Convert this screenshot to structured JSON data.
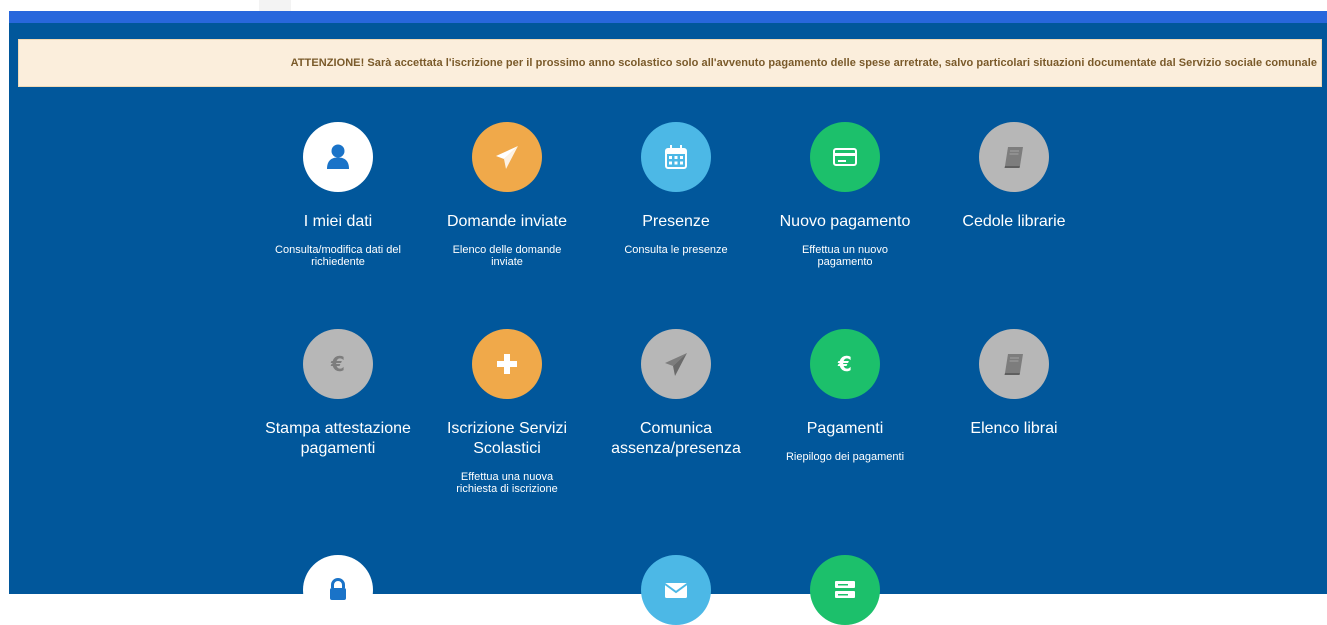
{
  "notice": {
    "text": "ATTENZIONE! Sarà accettata l'iscrizione per il prossimo anno scolastico solo all'avvenuto pagamento delle spese arretrate, salvo particolari situazioni documentate dal Servizio sociale comunale"
  },
  "tiles": [
    {
      "title": "I miei dati",
      "subtitle": "Consulta/modifica dati del richiedente",
      "icon": "user-icon",
      "color": "#ffffff"
    },
    {
      "title": "Domande inviate",
      "subtitle": "Elenco delle domande inviate",
      "icon": "paper-plane-icon",
      "color": "#f0a94a"
    },
    {
      "title": "Presenze",
      "subtitle": "Consulta le presenze",
      "icon": "calendar-icon",
      "color": "#4cb8e6"
    },
    {
      "title": "Nuovo pagamento",
      "subtitle": "Effettua un nuovo pagamento",
      "icon": "credit-card-icon",
      "color": "#1cc06b"
    },
    {
      "title": "Cedole librarie",
      "subtitle": "",
      "icon": "book-icon",
      "color": "#b7b7b7"
    },
    {
      "title": "Stampa attestazione pagamenti",
      "subtitle": "",
      "icon": "euro-icon",
      "color": "#b7b7b7"
    },
    {
      "title": "Iscrizione Servizi Scolastici",
      "subtitle": "Effettua una nuova richiesta di iscrizione",
      "icon": "plus-icon",
      "color": "#f0a94a"
    },
    {
      "title": "Comunica assenza/presenza",
      "subtitle": "",
      "icon": "paper-plane-icon",
      "color": "#b7b7b7"
    },
    {
      "title": "Pagamenti",
      "subtitle": "Riepilogo dei pagamenti",
      "icon": "euro-icon",
      "color": "#1cc06b"
    },
    {
      "title": "Elenco librai",
      "subtitle": "",
      "icon": "book-icon",
      "color": "#b7b7b7"
    },
    {
      "title": "",
      "subtitle": "",
      "icon": "lock-icon",
      "color": "#ffffff"
    },
    {
      "title": "",
      "subtitle": "",
      "icon": "envelope-icon",
      "color": "#4cb8e6"
    },
    {
      "title": "",
      "subtitle": "",
      "icon": "server-icon",
      "color": "#1cc06b"
    }
  ]
}
